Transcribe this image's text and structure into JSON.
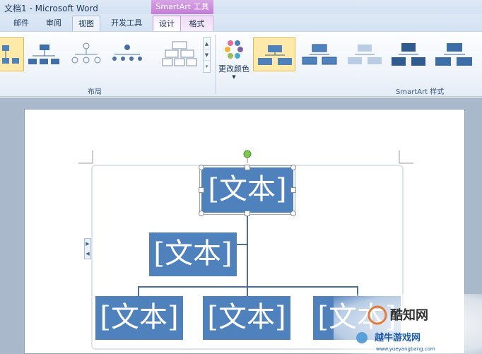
{
  "window": {
    "title": "文档1 - Microsoft Word",
    "context_header": "SmartArt 工具"
  },
  "tabs": [
    {
      "label": "邮件"
    },
    {
      "label": "审阅"
    },
    {
      "label": "视图"
    },
    {
      "label": "开发工具"
    },
    {
      "label": "设计"
    },
    {
      "label": "格式"
    }
  ],
  "ribbon": {
    "layout_group_label": "布局",
    "change_color_label": "更改颜色",
    "styles_group_label": "SmartArt 样式"
  },
  "diagram": {
    "root": "[文本]",
    "assistant": "[文本]",
    "children": [
      "[文本]",
      "[文本]",
      "[文本]"
    ]
  },
  "watermark": {
    "brand": "酷知网",
    "brand2": "越牛游戏网",
    "url": "www.yueyangbang.com"
  },
  "colors": {
    "node": "#4f81bd",
    "context_tab": "#c27dd6"
  }
}
